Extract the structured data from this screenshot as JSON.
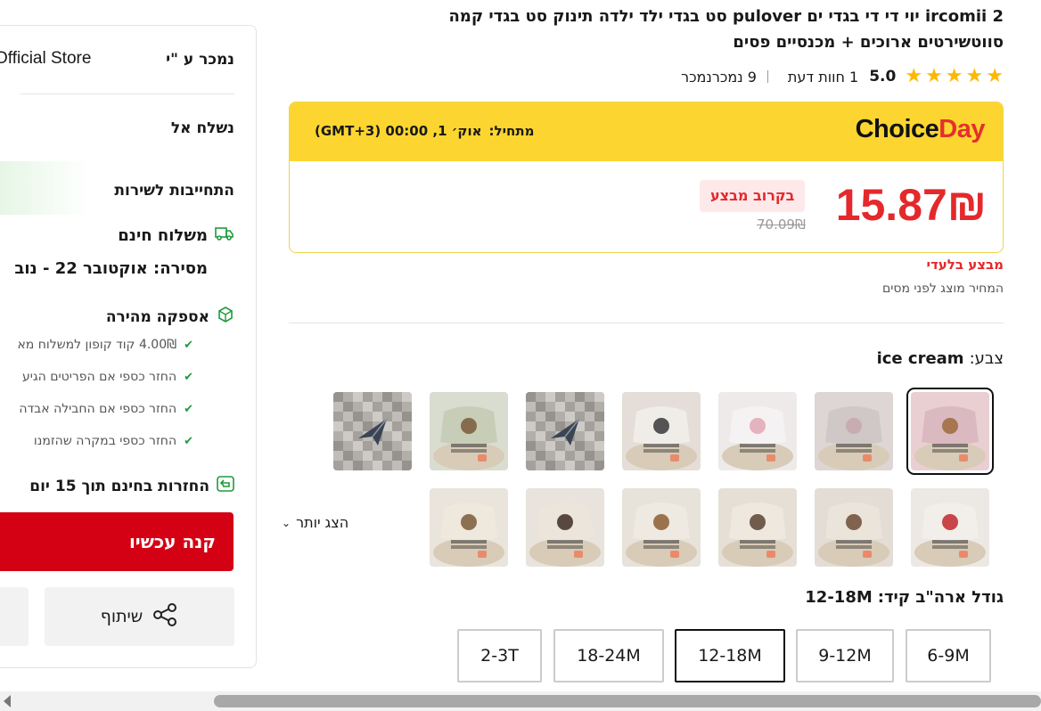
{
  "product": {
    "title_line1": "2 ircomii יוי די די בגדי ים pulover סט בגדי ילד ילדה תינוק סט בגדי קמה",
    "title_line2": "סווטשירטים ארוכים + מכנסיים פסים",
    "rating": "5.0",
    "stars": 5,
    "reviews_count": "1",
    "reviews_label": "חוות דעת",
    "sold_count": "9",
    "sold_label": "נמכרנמכר"
  },
  "choice": {
    "logo_part1": "Choice",
    "logo_part2": "Day",
    "start_label": "מתחיל:",
    "start_value": "אוק׳ 1, 00:00 (GMT+3)",
    "price": "15.87₪",
    "badge": "בקרוב מבצע",
    "old_price": "70.09₪",
    "exclusive": "מבצע בלעדי",
    "tax_note": "המחיר מוצג לפני מסים"
  },
  "color": {
    "label": "צבע:",
    "value": "ice cream",
    "thumbs_row1": [
      {
        "name": "ice-cream",
        "bg": "#e9cfd2",
        "shirt": "#dbb9c0",
        "accent": "#9c6a3d"
      },
      {
        "name": "gray-pink",
        "bg": "#ddd6d4",
        "shirt": "#cfc8c7",
        "accent": "#c7a7ad"
      },
      {
        "name": "white-pink",
        "bg": "#eeeaea",
        "shirt": "#f4f2f2",
        "accent": "#e2a7b7"
      },
      {
        "name": "white-stripes",
        "bg": "#e4ddd8",
        "shirt": "#f0ece8",
        "accent": "#3a3a3a"
      },
      {
        "name": "placeholder",
        "bg": "#b9b7b4",
        "shirt": "#9c9a98",
        "accent": "#333"
      },
      {
        "name": "green-pear",
        "bg": "#d9ddd0",
        "shirt": "#c7cdb7",
        "accent": "#7a5a3a"
      },
      {
        "name": "placeholder-2",
        "bg": "#a8a6a3",
        "shirt": "#8c8a87",
        "accent": "#333"
      }
    ],
    "thumbs_row2": [
      {
        "name": "strawberry",
        "bg": "#ece8e4",
        "shirt": "#f2eee9",
        "accent": "#c1272d"
      },
      {
        "name": "bear",
        "bg": "#e3ddd5",
        "shirt": "#ebe4da",
        "accent": "#6d4c35"
      },
      {
        "name": "dog",
        "bg": "#e6dfd6",
        "shirt": "#eee8df",
        "accent": "#5b4331"
      },
      {
        "name": "hedgehog",
        "bg": "#e7e2da",
        "shirt": "#eee9e1",
        "accent": "#8b5e34"
      },
      {
        "name": "dots",
        "bg": "#e8e3dc",
        "shirt": "#ece5db",
        "accent": "#3d2e22"
      },
      {
        "name": "lion",
        "bg": "#e9e4dc",
        "shirt": "#efe8dd",
        "accent": "#7a5a3a"
      }
    ],
    "show_more": "הצג יותר"
  },
  "size": {
    "label": "גודל ארה\"ב קיד:",
    "value": "12-18M",
    "options": [
      "6-9M",
      "9-12M",
      "12-18M",
      "18-24M",
      "2-3T"
    ]
  },
  "sidebar": {
    "seller_label": "נמכר ע \"י",
    "seller_value": "Official Store",
    "ship_to": "נשלח אל",
    "commitment": "התחייבות לשירות",
    "free_shipping": "משלוח חינם",
    "delivery": "מסירה: אוקטובר 22 - נוב",
    "fast_delivery": "אספקה מהירה",
    "bullets": [
      "4.00₪ קוד קופון למשלוח מא",
      "החזר כספי אם הפריטים הגיע",
      "החזר כספי אם החבילה אבדה",
      "החזר כספי במקרה שהזמנו"
    ],
    "free_returns": "החזרות בחינם תוך 15 יום",
    "buy_now": "קנה עכשיו",
    "share": "שיתוף"
  },
  "colors": {
    "accent_red": "#e4282b",
    "choice_yellow": "#fdd530",
    "buy_red": "#d40014",
    "green": "#1e9b3a"
  }
}
